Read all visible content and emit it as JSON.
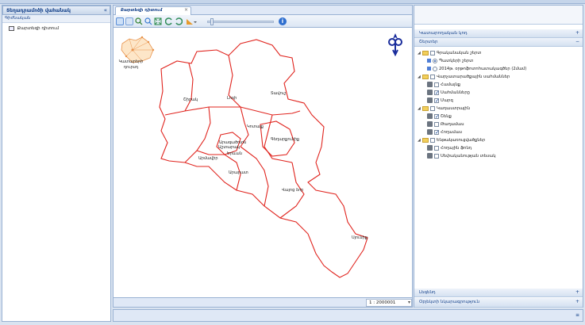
{
  "left_panel": {
    "title": "Տեղադրամոծի վահանակ",
    "section": "Գիժնական",
    "items": [
      {
        "label": "Քարտեզի դիտում"
      }
    ]
  },
  "tab": {
    "label": "Քարտեզի դիտում"
  },
  "zoom_slider": {
    "level": 0.05
  },
  "map": {
    "overview_label": "Կատարերի\nդուրսդ",
    "labels": [
      "Շիրակ",
      "Լոռի",
      "Տավուշ",
      "Արագածոտն",
      "Կոտայք",
      "Գեղարքունիք",
      "Երևան",
      "Արմավիր",
      "Արարատ",
      "Վայոց ձոր",
      "Սյունիք",
      "Աշտարակ"
    ]
  },
  "scale": {
    "value": "1 : 2000001"
  },
  "right_panel": {
    "sections": {
      "top": "Կատարողական կոդ",
      "layers": "Շերտեր",
      "legend": "Լեգենդ",
      "info": "Օբյեկտի նկարագրություն"
    },
    "tree": [
      {
        "type": "folder",
        "label": "Գրականական շերտ",
        "indent": 0,
        "toggle": "◢"
      },
      {
        "type": "radio",
        "label": "Պատկերի շերտ",
        "indent": 2,
        "checked": true
      },
      {
        "type": "radio",
        "label": "2014թ. օրթոֆոտոհատակագծեր (2մամ)",
        "indent": 2,
        "checked": false
      },
      {
        "type": "folder",
        "label": "Վարչատարածքային սահմաններ",
        "indent": 0,
        "toggle": "◢"
      },
      {
        "type": "layer",
        "label": "Համայնք",
        "indent": 2,
        "checked": false
      },
      {
        "type": "layer",
        "label": "Սահմանները",
        "indent": 2,
        "checked": true
      },
      {
        "type": "layer",
        "label": "Մարզ",
        "indent": 2,
        "checked": true
      },
      {
        "type": "folder",
        "label": "Կադաստրային",
        "indent": 0,
        "toggle": "◢"
      },
      {
        "type": "layer",
        "label": "Շենք",
        "indent": 2,
        "checked": true
      },
      {
        "type": "layer",
        "label": "Թաղամաս",
        "indent": 2,
        "checked": false
      },
      {
        "type": "layer",
        "label": "Հողամաս",
        "indent": 2,
        "checked": true
      },
      {
        "type": "folder",
        "label": "Ենթակառուցվածքներ",
        "indent": 0,
        "toggle": "◢"
      },
      {
        "type": "layer",
        "label": "Հողային ֆոնդ",
        "indent": 2,
        "checked": false
      },
      {
        "type": "layer",
        "label": "Սեփականության տեսակ",
        "indent": 2,
        "checked": false
      }
    ]
  }
}
